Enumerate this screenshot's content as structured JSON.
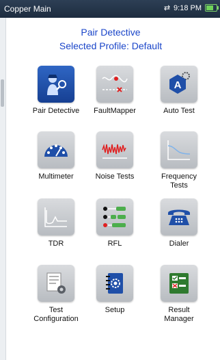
{
  "status_bar": {
    "title": "Copper Main",
    "time": "9:18 PM",
    "battery_level": 0.7
  },
  "header": {
    "line1": "Pair Detective",
    "line2": "Selected Profile:  Default"
  },
  "tiles": [
    {
      "label1": "Pair Detective",
      "label2": "",
      "icon": "pair-detective-icon"
    },
    {
      "label1": "FaultMapper",
      "label2": "",
      "icon": "faultmapper-icon"
    },
    {
      "label1": "Auto Test",
      "label2": "",
      "icon": "auto-test-icon"
    },
    {
      "label1": "Multimeter",
      "label2": "",
      "icon": "multimeter-icon"
    },
    {
      "label1": "Noise Tests",
      "label2": "",
      "icon": "noise-tests-icon"
    },
    {
      "label1": "Frequency",
      "label2": "Tests",
      "icon": "frequency-tests-icon"
    },
    {
      "label1": "TDR",
      "label2": "",
      "icon": "tdr-icon"
    },
    {
      "label1": "RFL",
      "label2": "",
      "icon": "rfl-icon"
    },
    {
      "label1": "Dialer",
      "label2": "",
      "icon": "dialer-icon"
    },
    {
      "label1": "Test",
      "label2": "Configuration",
      "icon": "test-configuration-icon"
    },
    {
      "label1": "Setup",
      "label2": "",
      "icon": "setup-icon"
    },
    {
      "label1": "Result",
      "label2": "Manager",
      "icon": "result-manager-icon"
    }
  ],
  "colors": {
    "accent": "#1a45c9",
    "tile_gray": "#c6c9cd",
    "tile_blue": "#1f4fa8"
  }
}
